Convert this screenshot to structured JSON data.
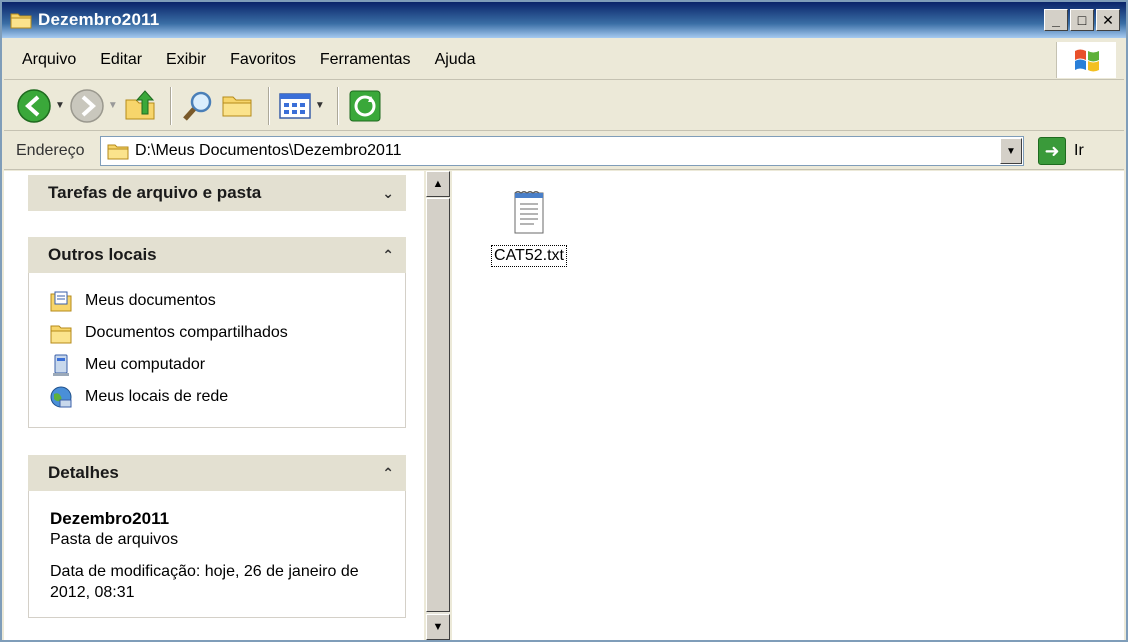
{
  "window": {
    "title": "Dezembro2011",
    "buttons": {
      "minimize": "_",
      "maximize": "□",
      "close": "✕"
    }
  },
  "menu": [
    {
      "label": "Arquivo"
    },
    {
      "label": "Editar"
    },
    {
      "label": "Exibir"
    },
    {
      "label": "Favoritos"
    },
    {
      "label": "Ferramentas"
    },
    {
      "label": "Ajuda"
    }
  ],
  "toolbar": {
    "icons": [
      "back-icon",
      "forward-icon",
      "up-folder-icon",
      "search-icon",
      "folders-icon",
      "views-icon",
      "sync-icon"
    ]
  },
  "address": {
    "label": "Endereço",
    "value": "D:\\Meus Documentos\\Dezembro2011",
    "go_label": "Ir"
  },
  "tasks": {
    "file_tasks_title": "Tarefas de arquivo e pasta",
    "other_places_title": "Outros locais",
    "other_places": [
      {
        "label": "Meus documentos",
        "icon": "my-documents-icon"
      },
      {
        "label": "Documentos compartilhados",
        "icon": "shared-folder-icon"
      },
      {
        "label": "Meu computador",
        "icon": "my-computer-icon"
      },
      {
        "label": "Meus locais de rede",
        "icon": "network-places-icon"
      }
    ],
    "details_title": "Detalhes",
    "details": {
      "name": "Dezembro2011",
      "type": "Pasta de arquivos",
      "modified": "Data de modificação: hoje, 26 de janeiro de 2012, 08:31"
    }
  },
  "files": [
    {
      "name": "CAT52.txt",
      "icon": "text-file-icon"
    }
  ],
  "colors": {
    "titlebar": "#0a246a",
    "panel_header": "#e3e0d1",
    "window_bg": "#ece9d8"
  }
}
